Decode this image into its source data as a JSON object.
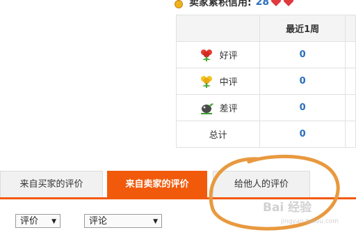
{
  "credit": {
    "label": "卖家累积信用:",
    "score": "28",
    "icons": [
      "medal-icon",
      "heart-icon",
      "heart-icon"
    ]
  },
  "stats": {
    "header": [
      "",
      "最近1周"
    ],
    "rows": [
      {
        "label": "好评",
        "icon": "red-flower-icon",
        "value": "0"
      },
      {
        "label": "中评",
        "icon": "yellow-flower-icon",
        "value": "0"
      },
      {
        "label": "差评",
        "icon": "dark-plant-icon",
        "value": "0"
      },
      {
        "label": "总计",
        "icon": "",
        "value": "0"
      }
    ]
  },
  "tabs": [
    {
      "label": "来自买家的评价",
      "active": false
    },
    {
      "label": "来自卖家的评价",
      "active": true
    },
    {
      "label": "给他人的评价",
      "active": false
    }
  ],
  "filters": {
    "rating": "评价",
    "comment": "评论"
  },
  "colors": {
    "accent": "#f25a0b",
    "link": "#2a6ebd",
    "annotation": "#e8993f"
  },
  "watermark": {
    "text": "Bai 经验",
    "sub": "jingyan.baidu.com"
  }
}
